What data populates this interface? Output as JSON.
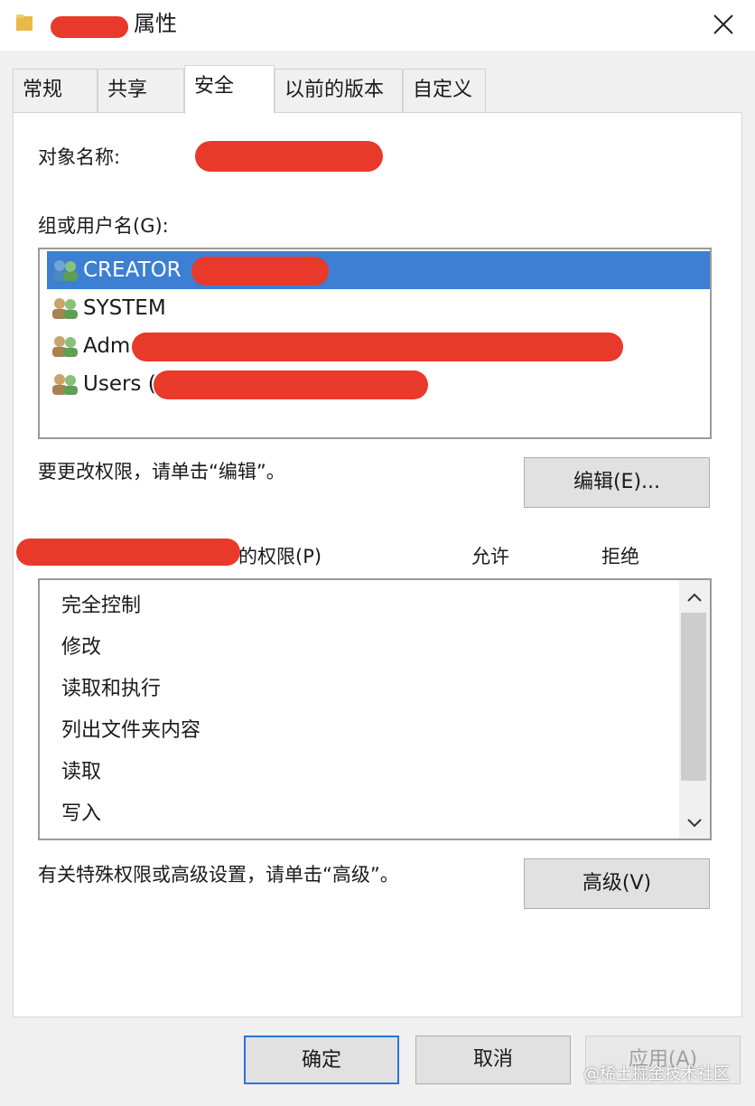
{
  "window": {
    "title_suffix": "属性",
    "close_icon": "close-icon"
  },
  "tabs": [
    {
      "label": "常规"
    },
    {
      "label": "共享"
    },
    {
      "label": "安全",
      "active": true
    },
    {
      "label": "以前的版本"
    },
    {
      "label": "自定义"
    }
  ],
  "security": {
    "object_name_label": "对象名称:",
    "groups_label": "组或用户名(G):",
    "groups": [
      {
        "name": "CREATOR",
        "icon": "users-icon",
        "selected": true
      },
      {
        "name": "SYSTEM",
        "icon": "users-icon"
      },
      {
        "name": "Adm",
        "icon": "users-icon"
      },
      {
        "name": "Users (",
        "icon": "users-icon"
      }
    ],
    "edit_hint": "要更改权限，请单击“编辑”。",
    "edit_button": "编辑(E)...",
    "permissions_label": "的权限(P)",
    "allow_header": "允许",
    "deny_header": "拒绝",
    "permissions": [
      "完全控制",
      "修改",
      "读取和执行",
      "列出文件夹内容",
      "读取",
      "写入"
    ],
    "advanced_hint": "有关特殊权限或高级设置，请单击“高级”。",
    "advanced_button": "高级(V)"
  },
  "footer": {
    "ok": "确定",
    "cancel": "取消",
    "apply": "应用(A)"
  },
  "watermark": "@稀土掘金技术社区",
  "colors": {
    "selection": "#3c7fd3",
    "redaction": "#e8392a",
    "default_button_border": "#2c74d4"
  }
}
